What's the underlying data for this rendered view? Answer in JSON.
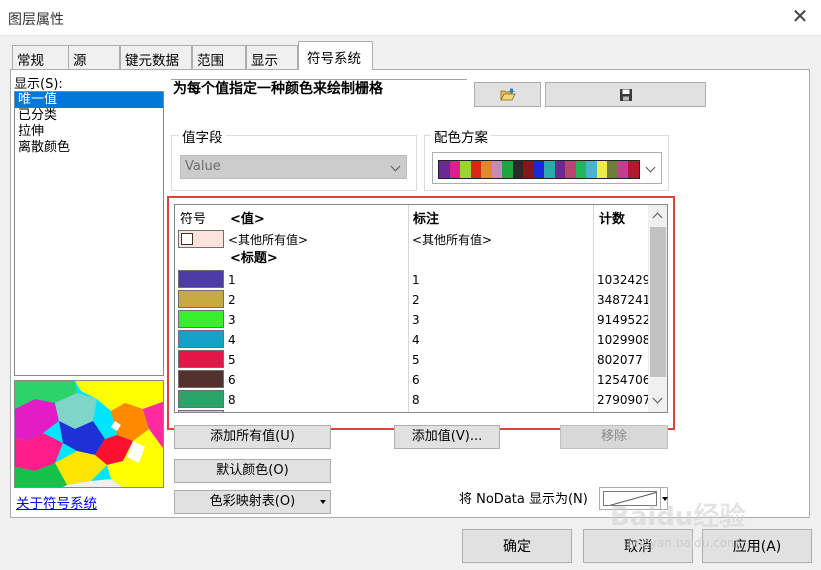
{
  "window": {
    "title": "图层属性"
  },
  "tabs": [
    {
      "label": "常规"
    },
    {
      "label": "源"
    },
    {
      "label": "键元数据"
    },
    {
      "label": "范围"
    },
    {
      "label": "显示"
    },
    {
      "label": "符号系统"
    }
  ],
  "show": {
    "label": "显示(S):",
    "items": [
      "唯一值",
      "已分类",
      "拉伸",
      "离散颜色"
    ],
    "selected": "唯一值"
  },
  "about_link": "关于符号系统",
  "description": "为每个值指定一种颜色来绘制栅格",
  "toolbar": {
    "open_icon": "folder-open-icon",
    "save_icon": "floppy-save-icon"
  },
  "value_field": {
    "title": "值字段",
    "value": "Value"
  },
  "color_scheme": {
    "title": "配色方案",
    "colors": [
      "#6a2b91",
      "#e21c8c",
      "#94d82c",
      "#d92619",
      "#e0892a",
      "#c989b6",
      "#1fa63a",
      "#2a2a2a",
      "#8c1418",
      "#1b28d6",
      "#2da9a9",
      "#6b2a8f",
      "#b9446f",
      "#24b65a",
      "#4bb2d6",
      "#f0ea4b",
      "#6f7d3c",
      "#c53b96",
      "#b2172b"
    ]
  },
  "table": {
    "headers": {
      "symbol": "符号",
      "value": "<值>",
      "label": "标注",
      "count": "计数"
    },
    "other": {
      "value": "<其他所有值>",
      "label": "<其他所有值>",
      "color": "#fce4dd"
    },
    "heading": "<标题>",
    "rows": [
      {
        "color": "#4d3ba6",
        "value": "1",
        "label": "1",
        "count": "1032429"
      },
      {
        "color": "#c6ab40",
        "value": "2",
        "label": "2",
        "count": "3487241"
      },
      {
        "color": "#38f02a",
        "value": "3",
        "label": "3",
        "count": "9149522"
      },
      {
        "color": "#14a2c9",
        "value": "4",
        "label": "4",
        "count": "1029908"
      },
      {
        "color": "#e41647",
        "value": "5",
        "label": "5",
        "count": "802077"
      },
      {
        "color": "#52312f",
        "value": "6",
        "label": "6",
        "count": "1254706"
      },
      {
        "color": "#28a468",
        "value": "8",
        "label": "8",
        "count": "2790907"
      }
    ],
    "partial_row_color": "#d9b8e0"
  },
  "buttons": {
    "add_all": "添加所有值(U)",
    "add_value": "添加值(V)...",
    "remove": "移除",
    "default_colors": "默认颜色(O)",
    "colormap": "色彩映射表(O)"
  },
  "nodata": {
    "label": "将 NoData 显示为(N)"
  },
  "footer": {
    "ok": "确定",
    "cancel": "取消",
    "apply": "应用(A)"
  },
  "watermark": {
    "text": "Baidu经验",
    "url": "jingyan.baidu.com"
  }
}
